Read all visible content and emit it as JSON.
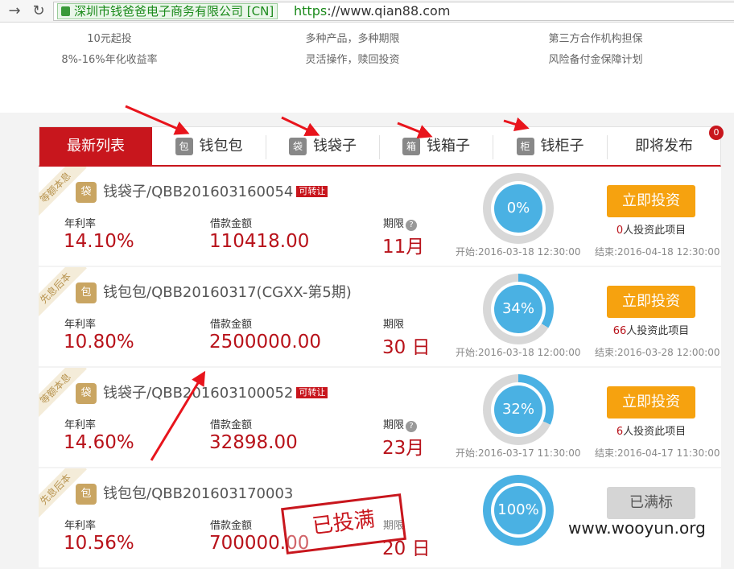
{
  "browser": {
    "ev_cert": "深圳市钱爸爸电子商务有限公司 [CN]",
    "url_scheme": "https",
    "url_rest": "://www.qian88.com"
  },
  "features": [
    {
      "lines": [
        "10元起投",
        "8%-16%年化收益率"
      ]
    },
    {
      "lines": [
        "多种产品，多种期限",
        "灵活操作，赎回投资"
      ]
    },
    {
      "lines": [
        "第三方合作机构担保",
        "风险备付金保障计划"
      ]
    }
  ],
  "tabs": [
    {
      "label": "最新列表",
      "icon": "",
      "active": true
    },
    {
      "label": "钱包包",
      "icon": "包"
    },
    {
      "label": "钱袋子",
      "icon": "袋"
    },
    {
      "label": "钱箱子",
      "icon": "箱"
    },
    {
      "label": "钱柜子",
      "icon": "柜"
    },
    {
      "label": "即将发布",
      "badge": "0"
    }
  ],
  "labels": {
    "rate": "年利率",
    "amount": "借款金额",
    "term": "期限",
    "invest_btn": "立即投资",
    "full_btn": "已满标",
    "count_suffix": "人投资此项目",
    "start_prefix": "开始:",
    "end_prefix": "结束:"
  },
  "products": [
    {
      "ribbon": "等额本息",
      "icon": "袋",
      "title": "钱袋子/QBB201603160054",
      "tag": "可转让",
      "rate": "14.10%",
      "amount": "110418.00",
      "term": "11月",
      "term_help": true,
      "progress": 0,
      "progress_label": "0%",
      "count": "0",
      "start": "2016-03-18 12:30:00",
      "end": "2016-04-18 12:30:00",
      "status": "invest"
    },
    {
      "ribbon": "先息后本",
      "icon": "包",
      "title": "钱包包/QBB20160317(CGXX-第5期)",
      "tag": "",
      "rate": "10.80%",
      "amount": "2500000.00",
      "term": "30 日",
      "term_help": false,
      "progress": 0.34,
      "progress_label": "34%",
      "count": "66",
      "start": "2016-03-18 12:00:00",
      "end": "2016-03-28 12:00:00",
      "status": "invest"
    },
    {
      "ribbon": "等额本息",
      "icon": "袋",
      "title": "钱袋子/QBB201603100052",
      "tag": "可转让",
      "rate": "14.60%",
      "amount": "32898.00",
      "term": "23月",
      "term_help": true,
      "progress": 0.32,
      "progress_label": "32%",
      "count": "6",
      "start": "2016-03-17 11:30:00",
      "end": "2016-04-17 11:30:00",
      "status": "invest"
    },
    {
      "ribbon": "先息后本",
      "icon": "包",
      "title": "钱包包/QBB201603170003",
      "tag": "",
      "rate": "10.56%",
      "amount": "700000.00",
      "term": "20 日",
      "term_help": false,
      "progress": 1,
      "progress_label": "100%",
      "count": "",
      "start": "",
      "end": "",
      "status": "full"
    }
  ],
  "stamp": "已投满",
  "watermark": "www.wooyun.org",
  "colors": {
    "brand_red": "#c8161d",
    "value_red": "#b8121a",
    "invest_orange": "#f6a20f",
    "progress_blue": "#4ab1e3",
    "ev_green": "#1a8a1a"
  },
  "annotation": {
    "arrow_color": "#e8141c"
  }
}
